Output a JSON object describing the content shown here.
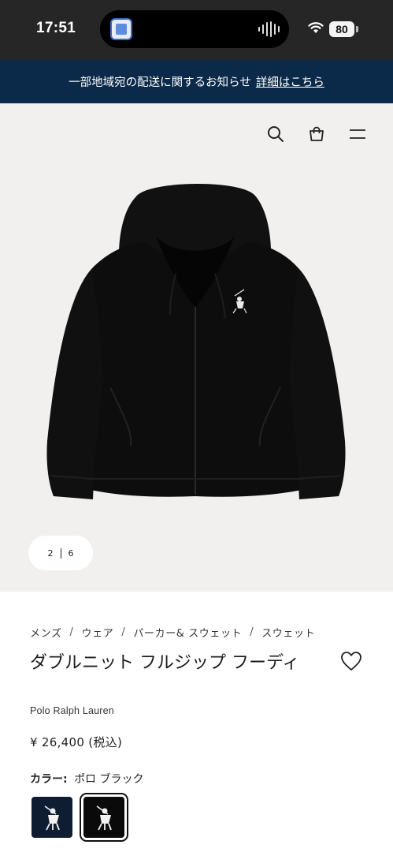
{
  "status_bar": {
    "time": "17:51",
    "battery": "80"
  },
  "notice": {
    "text": "一部地域宛の配送に関するお知らせ",
    "link": "詳細はこちら"
  },
  "header": {
    "icons": [
      "search-icon",
      "shopping-bag-icon",
      "menu-icon"
    ]
  },
  "gallery": {
    "current": "2",
    "total": "6"
  },
  "breadcrumb": [
    "メンズ",
    "ウェア",
    "パーカー& スウェット",
    "スウェット"
  ],
  "product": {
    "title": "ダブルニット フルジップ フーディ",
    "brand": "Polo Ralph Lauren",
    "price": "¥ 26,400 (税込)",
    "color_label": "カラー:",
    "color_value": "ポロ ブラック"
  },
  "swatches": [
    {
      "color": "#0f1d33",
      "selected": false
    },
    {
      "color": "#0a0a0a",
      "selected": true
    }
  ],
  "colors": {
    "notice_bg": "#0b2a4a",
    "hero_bg": "#f1f0ee",
    "status_bg": "#262626"
  }
}
